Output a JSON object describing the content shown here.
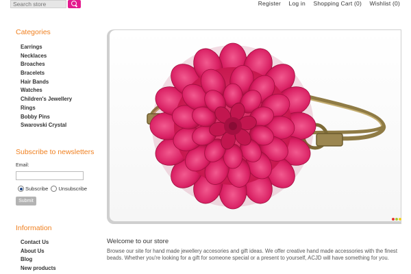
{
  "header": {
    "search_placeholder": "Search store",
    "links": {
      "register": "Register",
      "login": "Log in",
      "cart": "Shopping Cart",
      "cart_count": "(0)",
      "wishlist": "Wishlist",
      "wishlist_count": "(0)"
    }
  },
  "sidebar": {
    "categories_title": "Categories",
    "categories": [
      "Earrings",
      "Necklaces",
      "Broaches",
      "Bracelets",
      "Hair Bands",
      "Watches",
      "Children's Jewellery",
      "Rings",
      "Bobby Pins",
      "Swarovski Crystal"
    ],
    "newsletter": {
      "title": "Subscribe to newsletters",
      "email_label": "Email:",
      "subscribe_label": "Subscribe",
      "unsubscribe_label": "Unsubscribe",
      "submit_label": "Submit"
    },
    "information_title": "Information",
    "information": [
      "Contact Us",
      "About Us",
      "Blog",
      "New products"
    ]
  },
  "slider": {
    "dot_colors": [
      "#e8352d",
      "#a8c93a",
      "#f4cf1e"
    ]
  },
  "welcome": {
    "title": "Welcome to our store",
    "text": "Browse our site for hand made jewellery accesories and gift ideas. We offer creative hand made accessories with the finest beads. Whether you're looking for a gift for someone special or a present to yourself, ACJD will have something for you."
  },
  "colors": {
    "accent": "#f08020",
    "brand_pink": "#e31b8e"
  }
}
